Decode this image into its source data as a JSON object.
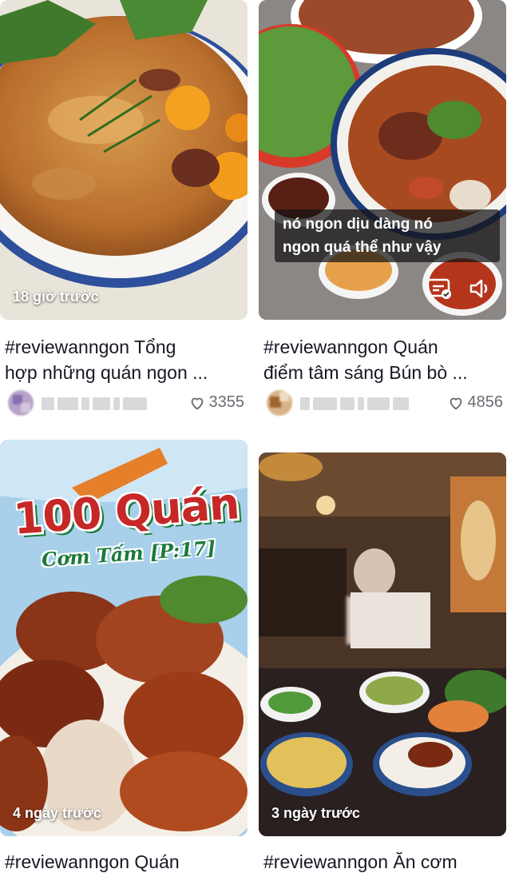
{
  "cards": [
    {
      "time": "18 giờ trước",
      "title_line1": "#reviewanngon Tổng",
      "title_line2": "hợp những quán ngon ...",
      "likes": "3355"
    },
    {
      "time": "",
      "caption_line1": "nó ngon dịu dàng nó",
      "caption_line2": "ngon quá thể như vậy",
      "title_line1": "#reviewanngon Quán",
      "title_line2": "điểm tâm sáng Bún bò ...",
      "likes": "4856"
    },
    {
      "time": "4 ngày trước",
      "overlay_big": "100 Quán",
      "overlay_sub": "Cơm Tấm [P:17]",
      "title_line1": "#reviewanngon Quán"
    },
    {
      "time": "3 ngày trước",
      "title_line1": "#reviewanngon Ăn cơm"
    }
  ],
  "icons": {
    "like": "heart-outline-icon",
    "caption": "closed-caption-icon",
    "sound": "speaker-icon"
  },
  "colors": {
    "text": "#161823",
    "muted": "#6b6b73",
    "overlay_red": "#c62828",
    "overlay_green": "#1b7a3a"
  }
}
